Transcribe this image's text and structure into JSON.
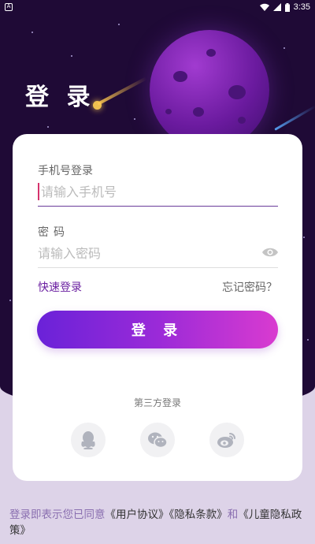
{
  "status_bar": {
    "time": "3:35"
  },
  "title": "登 录",
  "phone": {
    "label": "手机号登录",
    "placeholder": "请输入手机号"
  },
  "password": {
    "label": "密码",
    "placeholder": "请输入密码"
  },
  "links": {
    "quick_login": "快速登录",
    "forgot": "忘记密码？"
  },
  "login_button": "登 录",
  "third_party": {
    "label": "第三方登录",
    "providers": [
      "qq-icon",
      "wechat-icon",
      "weibo-icon"
    ]
  },
  "agreement": {
    "prefix": "登录即表示您已同意",
    "user_agreement": "《用户协议》",
    "privacy": "《隐私条款》",
    "and": "和",
    "child_privacy": "《儿童隐私政策》"
  },
  "colors": {
    "accent": "#6a1fa0",
    "gradient_start": "#6a22d8",
    "gradient_end": "#d93bd0",
    "background": "#1f0a36"
  }
}
